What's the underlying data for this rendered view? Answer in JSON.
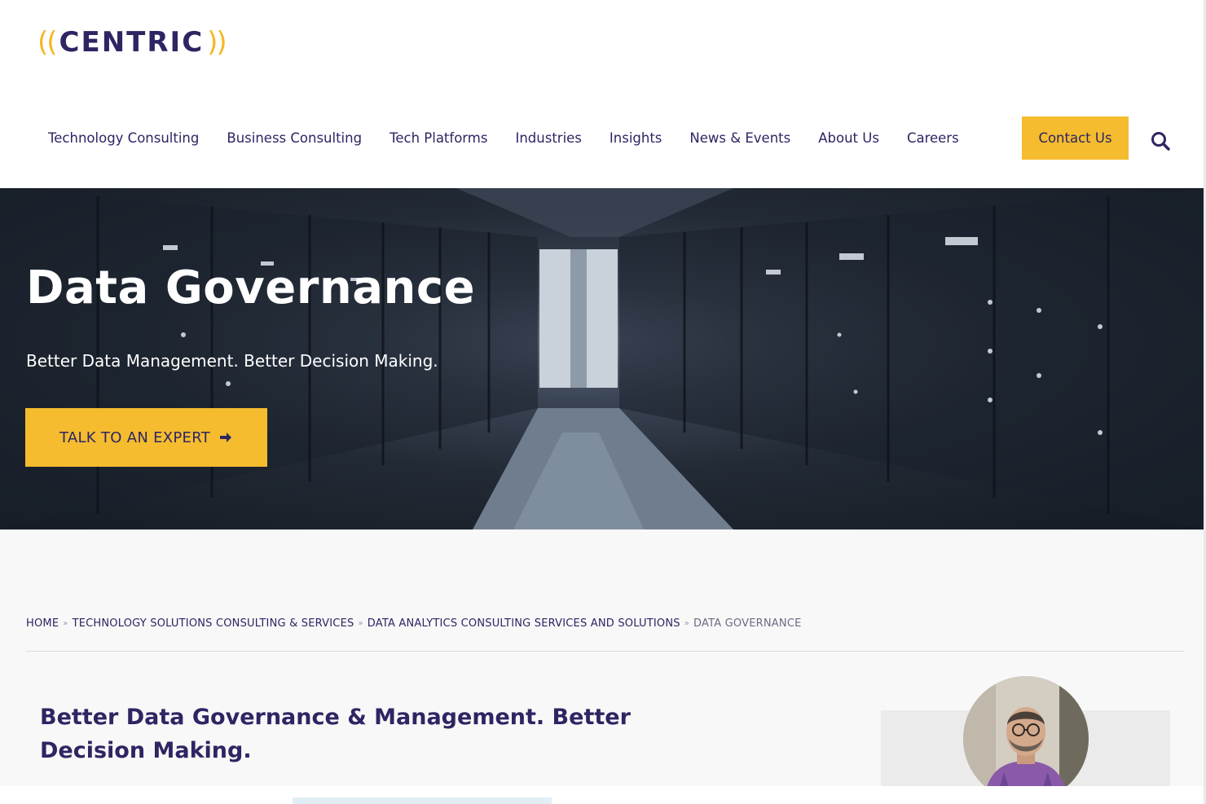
{
  "brand": {
    "logo_left": "((",
    "logo_word": "CENTRIC",
    "logo_right": "))",
    "accent_color": "#f4bc2e",
    "primary_color": "#2e2563"
  },
  "nav": {
    "items": [
      {
        "label": "Technology Consulting"
      },
      {
        "label": "Business Consulting"
      },
      {
        "label": "Tech Platforms"
      },
      {
        "label": "Industries"
      },
      {
        "label": "Insights"
      },
      {
        "label": "News & Events"
      },
      {
        "label": "About Us"
      },
      {
        "label": "Careers"
      }
    ],
    "contact_label": "Contact Us",
    "search_icon": "search-icon"
  },
  "hero": {
    "title": "Data Governance",
    "subtitle": "Better Data Management. Better Decision Making.",
    "cta_label": "TALK TO AN EXPERT",
    "cta_icon": "arrow-right-icon"
  },
  "breadcrumb": {
    "items": [
      {
        "label": "HOME"
      },
      {
        "label": "TECHNOLOGY SOLUTIONS CONSULTING & SERVICES"
      },
      {
        "label": "DATA ANALYTICS CONSULTING SERVICES AND SOLUTIONS"
      }
    ],
    "separator": "»",
    "current": "DATA GOVERNANCE"
  },
  "main": {
    "section_title": "Better Data Governance & Management. Better Decision Making."
  }
}
